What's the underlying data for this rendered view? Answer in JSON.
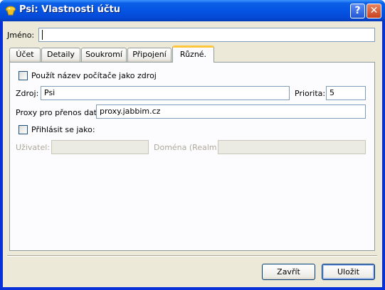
{
  "window": {
    "title": "Psi: Vlastnosti účtu",
    "help_glyph": "?",
    "close_glyph": "✕"
  },
  "name": {
    "label": "Jméno:",
    "value": ""
  },
  "tabs": [
    {
      "label": "Účet"
    },
    {
      "label": "Detaily"
    },
    {
      "label": "Soukromí"
    },
    {
      "label": "Připojení"
    },
    {
      "label": "Různé.",
      "active": true
    }
  ],
  "misc": {
    "use_hostname_label": "Použít název počítače jako zdroj",
    "use_hostname_checked": false,
    "resource_label": "Zdroj:",
    "resource_value": "Psi",
    "priority_label": "Priorita:",
    "priority_value": "5",
    "proxy_label": "Proxy pro přenos dat:",
    "proxy_value": "proxy.jabbim.cz",
    "login_as_label": "Přihlásit se jako:",
    "login_as_checked": false,
    "user_label": "Uživatel:",
    "user_value": "",
    "realm_label": "Doména (Realm):",
    "realm_value": ""
  },
  "buttons": {
    "close": "Zavřít",
    "save": "Uložit"
  },
  "colors": {
    "titlebar": "#0554e3",
    "dialog_bg": "#ece9d8",
    "active_tab_accent": "#ffc83c"
  }
}
